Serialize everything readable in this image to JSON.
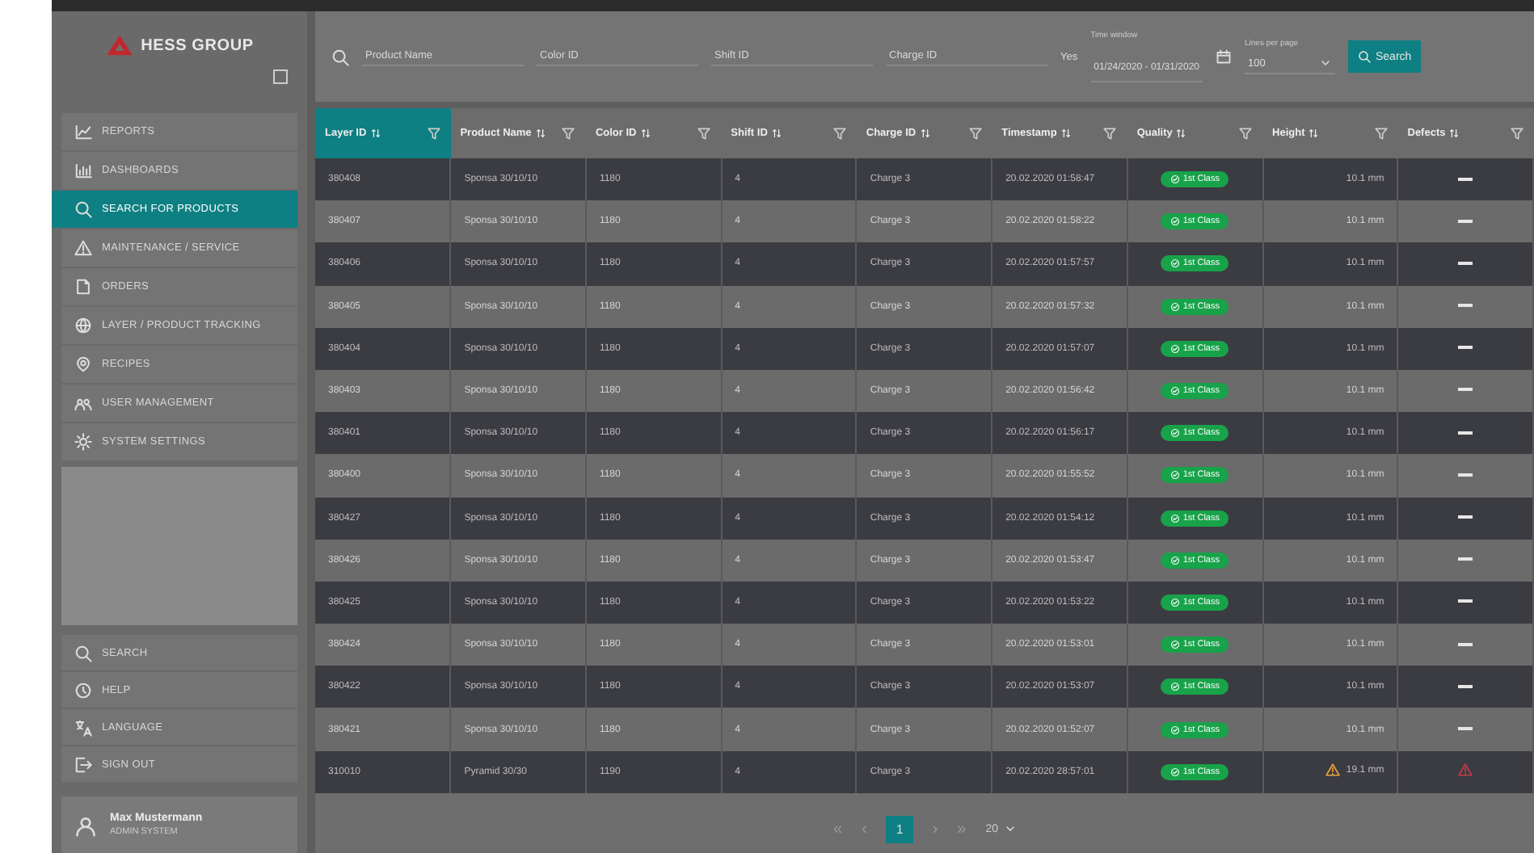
{
  "sidebar": {
    "logo": "HESS GROUP",
    "items": [
      {
        "label": "REPORTS",
        "selected": false
      },
      {
        "label": "DASHBOARDS",
        "selected": false
      },
      {
        "label": "SEARCH FOR PRODUCTS",
        "selected": true
      },
      {
        "label": "MAINTENANCE / SERVICE",
        "selected": false
      },
      {
        "label": "ORDERS",
        "selected": false
      },
      {
        "label": "LAYER / PRODUCT TRACKING",
        "selected": false
      },
      {
        "label": "RECIPES",
        "selected": false
      },
      {
        "label": "USER MANAGEMENT",
        "selected": false
      },
      {
        "label": "SYSTEM SETTINGS",
        "selected": false
      }
    ],
    "bottom_items": [
      {
        "label": "SEARCH"
      },
      {
        "label": "HELP"
      },
      {
        "label": "LANGUAGE"
      },
      {
        "label": "SIGN OUT"
      }
    ],
    "user": {
      "name": "Max Mustermann",
      "role": "ADMIN SYSTEM"
    }
  },
  "filters": {
    "fields": [
      {
        "placeholder": "Product Name"
      },
      {
        "placeholder": "Color ID"
      },
      {
        "placeholder": "Shift ID"
      },
      {
        "placeholder": "Charge ID"
      }
    ],
    "toggle": "Yes",
    "date_label": "Time window",
    "date_value": "01/24/2020 - 01/31/2020",
    "lines_label": "Lines per page",
    "lines_value": "100",
    "search_button": "Search"
  },
  "table": {
    "columns": [
      {
        "label": "Layer ID",
        "selected": true
      },
      {
        "label": "Product Name",
        "selected": false
      },
      {
        "label": "Color ID",
        "selected": false
      },
      {
        "label": "Shift ID",
        "selected": false
      },
      {
        "label": "Charge ID",
        "selected": false
      },
      {
        "label": "Timestamp",
        "selected": false
      },
      {
        "label": "Quality",
        "selected": false
      },
      {
        "label": "Height",
        "selected": false
      },
      {
        "label": "Defects",
        "selected": false
      }
    ],
    "rows": [
      {
        "cells": [
          "380408",
          "Sponsa 30/10/10",
          "1180",
          "4",
          "Charge 3",
          "20.02.2020 01:58:47",
          "1st Class",
          "10.1 mm"
        ],
        "height_warning": false,
        "defect_alert": false
      },
      {
        "cells": [
          "380407",
          "Sponsa 30/10/10",
          "1180",
          "4",
          "Charge 3",
          "20.02.2020 01:58:22",
          "1st Class",
          "10.1 mm"
        ],
        "height_warning": false,
        "defect_alert": false
      },
      {
        "cells": [
          "380406",
          "Sponsa 30/10/10",
          "1180",
          "4",
          "Charge 3",
          "20.02.2020 01:57:57",
          "1st Class",
          "10.1 mm"
        ],
        "height_warning": false,
        "defect_alert": false
      },
      {
        "cells": [
          "380405",
          "Sponsa 30/10/10",
          "1180",
          "4",
          "Charge 3",
          "20.02.2020 01:57:32",
          "1st Class",
          "10.1 mm"
        ],
        "height_warning": false,
        "defect_alert": false
      },
      {
        "cells": [
          "380404",
          "Sponsa 30/10/10",
          "1180",
          "4",
          "Charge 3",
          "20.02.2020 01:57:07",
          "1st Class",
          "10.1 mm"
        ],
        "height_warning": false,
        "defect_alert": false
      },
      {
        "cells": [
          "380403",
          "Sponsa 30/10/10",
          "1180",
          "4",
          "Charge 3",
          "20.02.2020 01:56:42",
          "1st Class",
          "10.1 mm"
        ],
        "height_warning": false,
        "defect_alert": false
      },
      {
        "cells": [
          "380401",
          "Sponsa 30/10/10",
          "1180",
          "4",
          "Charge 3",
          "20.02.2020 01:56:17",
          "1st Class",
          "10.1 mm"
        ],
        "height_warning": false,
        "defect_alert": false
      },
      {
        "cells": [
          "380400",
          "Sponsa 30/10/10",
          "1180",
          "4",
          "Charge 3",
          "20.02.2020 01:55:52",
          "1st Class",
          "10.1 mm"
        ],
        "height_warning": false,
        "defect_alert": false
      },
      {
        "cells": [
          "380427",
          "Sponsa 30/10/10",
          "1180",
          "4",
          "Charge 3",
          "20.02.2020 01:54:12",
          "1st Class",
          "10.1 mm"
        ],
        "height_warning": false,
        "defect_alert": false
      },
      {
        "cells": [
          "380426",
          "Sponsa 30/10/10",
          "1180",
          "4",
          "Charge 3",
          "20.02.2020 01:53:47",
          "1st Class",
          "10.1 mm"
        ],
        "height_warning": false,
        "defect_alert": false
      },
      {
        "cells": [
          "380425",
          "Sponsa 30/10/10",
          "1180",
          "4",
          "Charge 3",
          "20.02.2020 01:53:22",
          "1st Class",
          "10.1 mm"
        ],
        "height_warning": false,
        "defect_alert": false
      },
      {
        "cells": [
          "380424",
          "Sponsa 30/10/10",
          "1180",
          "4",
          "Charge 3",
          "20.02.2020 01:53:01",
          "1st Class",
          "10.1 mm"
        ],
        "height_warning": false,
        "defect_alert": false
      },
      {
        "cells": [
          "380422",
          "Sponsa 30/10/10",
          "1180",
          "4",
          "Charge 3",
          "20.02.2020 01:53:07",
          "1st Class",
          "10.1 mm"
        ],
        "height_warning": false,
        "defect_alert": false
      },
      {
        "cells": [
          "380421",
          "Sponsa 30/10/10",
          "1180",
          "4",
          "Charge 3",
          "20.02.2020 01:52:07",
          "1st Class",
          "10.1 mm"
        ],
        "height_warning": false,
        "defect_alert": false
      },
      {
        "cells": [
          "310010",
          "Pyramid 30/30",
          "1190",
          "4",
          "Charge 3",
          "20.02.2020 28:57:01",
          "1st Class",
          "19.1 mm"
        ],
        "height_warning": true,
        "defect_alert": true
      }
    ]
  },
  "pagination": {
    "first": "«",
    "prev": "‹",
    "pages": [
      {
        "label": "1",
        "selected": true
      }
    ],
    "next": "›",
    "last": "»",
    "page_size": "20"
  }
}
